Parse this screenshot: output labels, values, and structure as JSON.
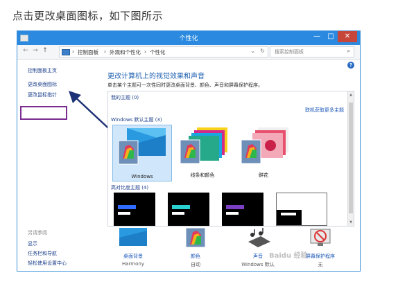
{
  "caption": "点击更改桌面图标，如下图所示",
  "window": {
    "title": "个性化",
    "buttons": {
      "minimize": "—",
      "maximize": "□",
      "close": "✕"
    }
  },
  "address": {
    "back": "←",
    "forward": "→",
    "up": "↑",
    "crumbs": [
      "控制面板",
      "外观和个性化",
      "个性化"
    ],
    "separator": "›",
    "refresh": "↻",
    "dropdown": "⌄",
    "search_placeholder": "搜索控制面板",
    "search_icon": "⌕"
  },
  "help": "?",
  "leftnav": {
    "home": "控制面板主页",
    "change_desktop_icons": "更改桌面图标",
    "change_mouse_pointers": "更改鼠标指针",
    "see_also": "另请参阅",
    "links": [
      "显示",
      "任务栏和导航",
      "轻松使用设置中心"
    ]
  },
  "main": {
    "title": "更改计算机上的视觉效果和声音",
    "description": "单击某个主题可一次性同时更改桌面背景、颜色、声音和屏幕保护程序。",
    "my_themes": "我的主题 (0)",
    "get_online": "联机获取更多主题",
    "default_themes": "Windows 默认主题 (3)",
    "themes": [
      {
        "label": "Windows",
        "selected": true
      },
      {
        "label": "线条和颜色",
        "selected": false
      },
      {
        "label": "鲜花",
        "selected": false
      }
    ],
    "high_contrast": "高对比度主题 (4)"
  },
  "bottom": [
    {
      "label": "桌面背景",
      "sub": "Harmony"
    },
    {
      "label": "颜色",
      "sub": "自动"
    },
    {
      "label": "声音",
      "sub": "Windows 默认"
    },
    {
      "label": "屏幕保护程序",
      "sub": "无"
    }
  ],
  "watermark": "Baidu 经验",
  "colors": {
    "accent": "#2b8ae0",
    "link": "#1a3e8a",
    "highlight": "#7b2c8f",
    "close": "#c7463b"
  }
}
